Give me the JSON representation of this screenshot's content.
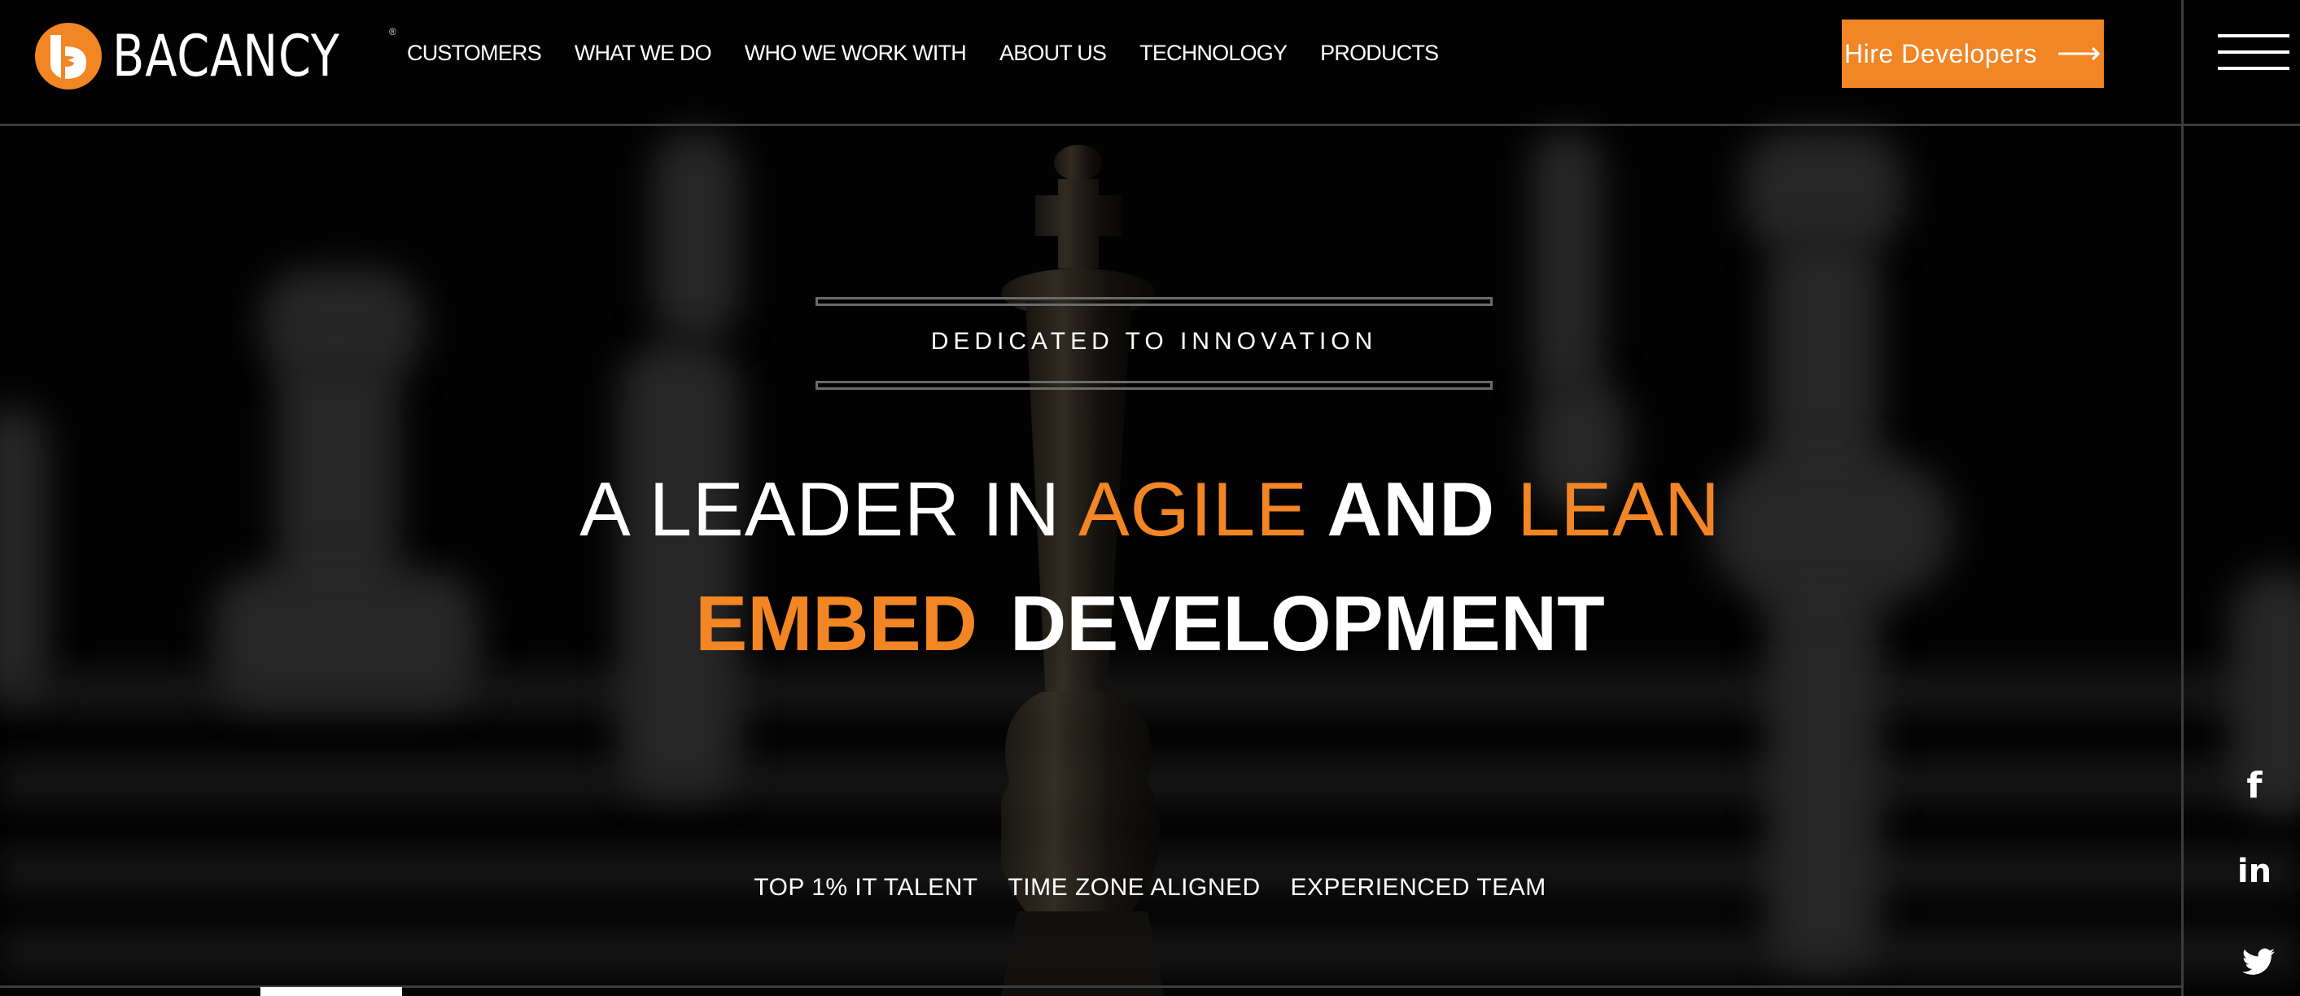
{
  "brand": {
    "name": "BACANCY",
    "registered_mark": "®",
    "logo_icon": "bacancy-b-logo-icon",
    "accent_color": "#f28524"
  },
  "nav": {
    "items": [
      {
        "label": "CUSTOMERS"
      },
      {
        "label": "WHAT WE DO"
      },
      {
        "label": "WHO WE WORK WITH"
      },
      {
        "label": "ABOUT US"
      },
      {
        "label": "TECHNOLOGY"
      },
      {
        "label": "PRODUCTS"
      }
    ]
  },
  "header": {
    "cta_label": "Hire Developers",
    "cta_icon": "arrow-right-icon",
    "menu_icon": "hamburger-menu-icon"
  },
  "hero": {
    "tagline": "DEDICATED TO INNOVATION",
    "headline_line1": {
      "part1": "A LEADER IN ",
      "part2": "AGILE",
      "part3": " AND ",
      "part4": "LEAN"
    },
    "headline_line2": {
      "part1": "EMBED",
      "part2": "DEVELOPMENT"
    },
    "features": [
      {
        "label": "TOP 1% IT TALENT"
      },
      {
        "label": "TIME ZONE ALIGNED"
      },
      {
        "label": "EXPERIENCED TEAM"
      }
    ],
    "background": "blurred chess pieces with king in focus"
  },
  "social": {
    "items": [
      {
        "name": "facebook",
        "glyph": "f"
      },
      {
        "name": "linkedin",
        "glyph": "in"
      },
      {
        "name": "twitter",
        "glyph": ""
      }
    ]
  }
}
